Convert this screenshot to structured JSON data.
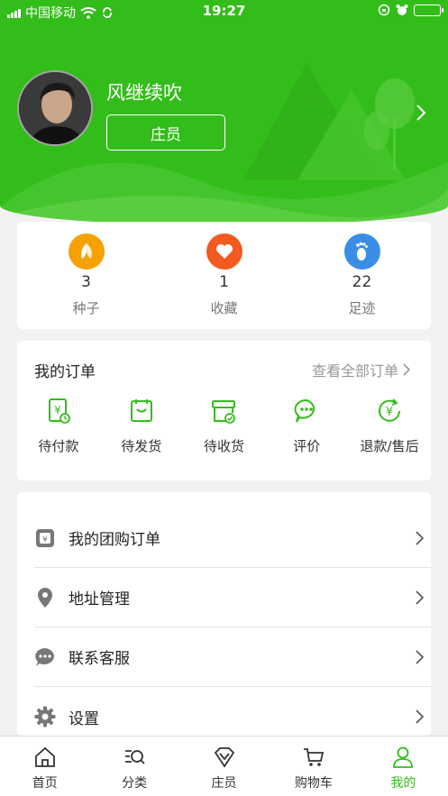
{
  "status_bar": {
    "carrier": "中国移动",
    "time": "19:27"
  },
  "profile": {
    "name": "风继续吹",
    "member_label": "庄员"
  },
  "stats": [
    {
      "icon": "seed-icon",
      "value": "3",
      "label": "种子",
      "color": "#f5a200"
    },
    {
      "icon": "heart-icon",
      "value": "1",
      "label": "收藏",
      "color": "#f25a1f"
    },
    {
      "icon": "footprint-icon",
      "value": "22",
      "label": "足迹",
      "color": "#3a8ee6"
    }
  ],
  "orders": {
    "title": "我的订单",
    "view_all": "查看全部订单",
    "items": [
      {
        "icon": "pending-payment-icon",
        "label": "待付款"
      },
      {
        "icon": "pending-ship-icon",
        "label": "待发货"
      },
      {
        "icon": "pending-receive-icon",
        "label": "待收货"
      },
      {
        "icon": "review-icon",
        "label": "评价"
      },
      {
        "icon": "refund-icon",
        "label": "退款/售后"
      }
    ]
  },
  "menu": [
    {
      "icon": "group-buy-icon",
      "label": "我的团购订单"
    },
    {
      "icon": "location-icon",
      "label": "地址管理"
    },
    {
      "icon": "chat-icon",
      "label": "联系客服"
    },
    {
      "icon": "gear-icon",
      "label": "设置"
    }
  ],
  "tabs": [
    {
      "icon": "home-icon",
      "label": "首页"
    },
    {
      "icon": "category-icon",
      "label": "分类"
    },
    {
      "icon": "member-icon",
      "label": "庄员"
    },
    {
      "icon": "cart-icon",
      "label": "购物车"
    },
    {
      "icon": "profile-icon",
      "label": "我的",
      "active": true
    }
  ],
  "colors": {
    "brand": "#33bd1a"
  }
}
